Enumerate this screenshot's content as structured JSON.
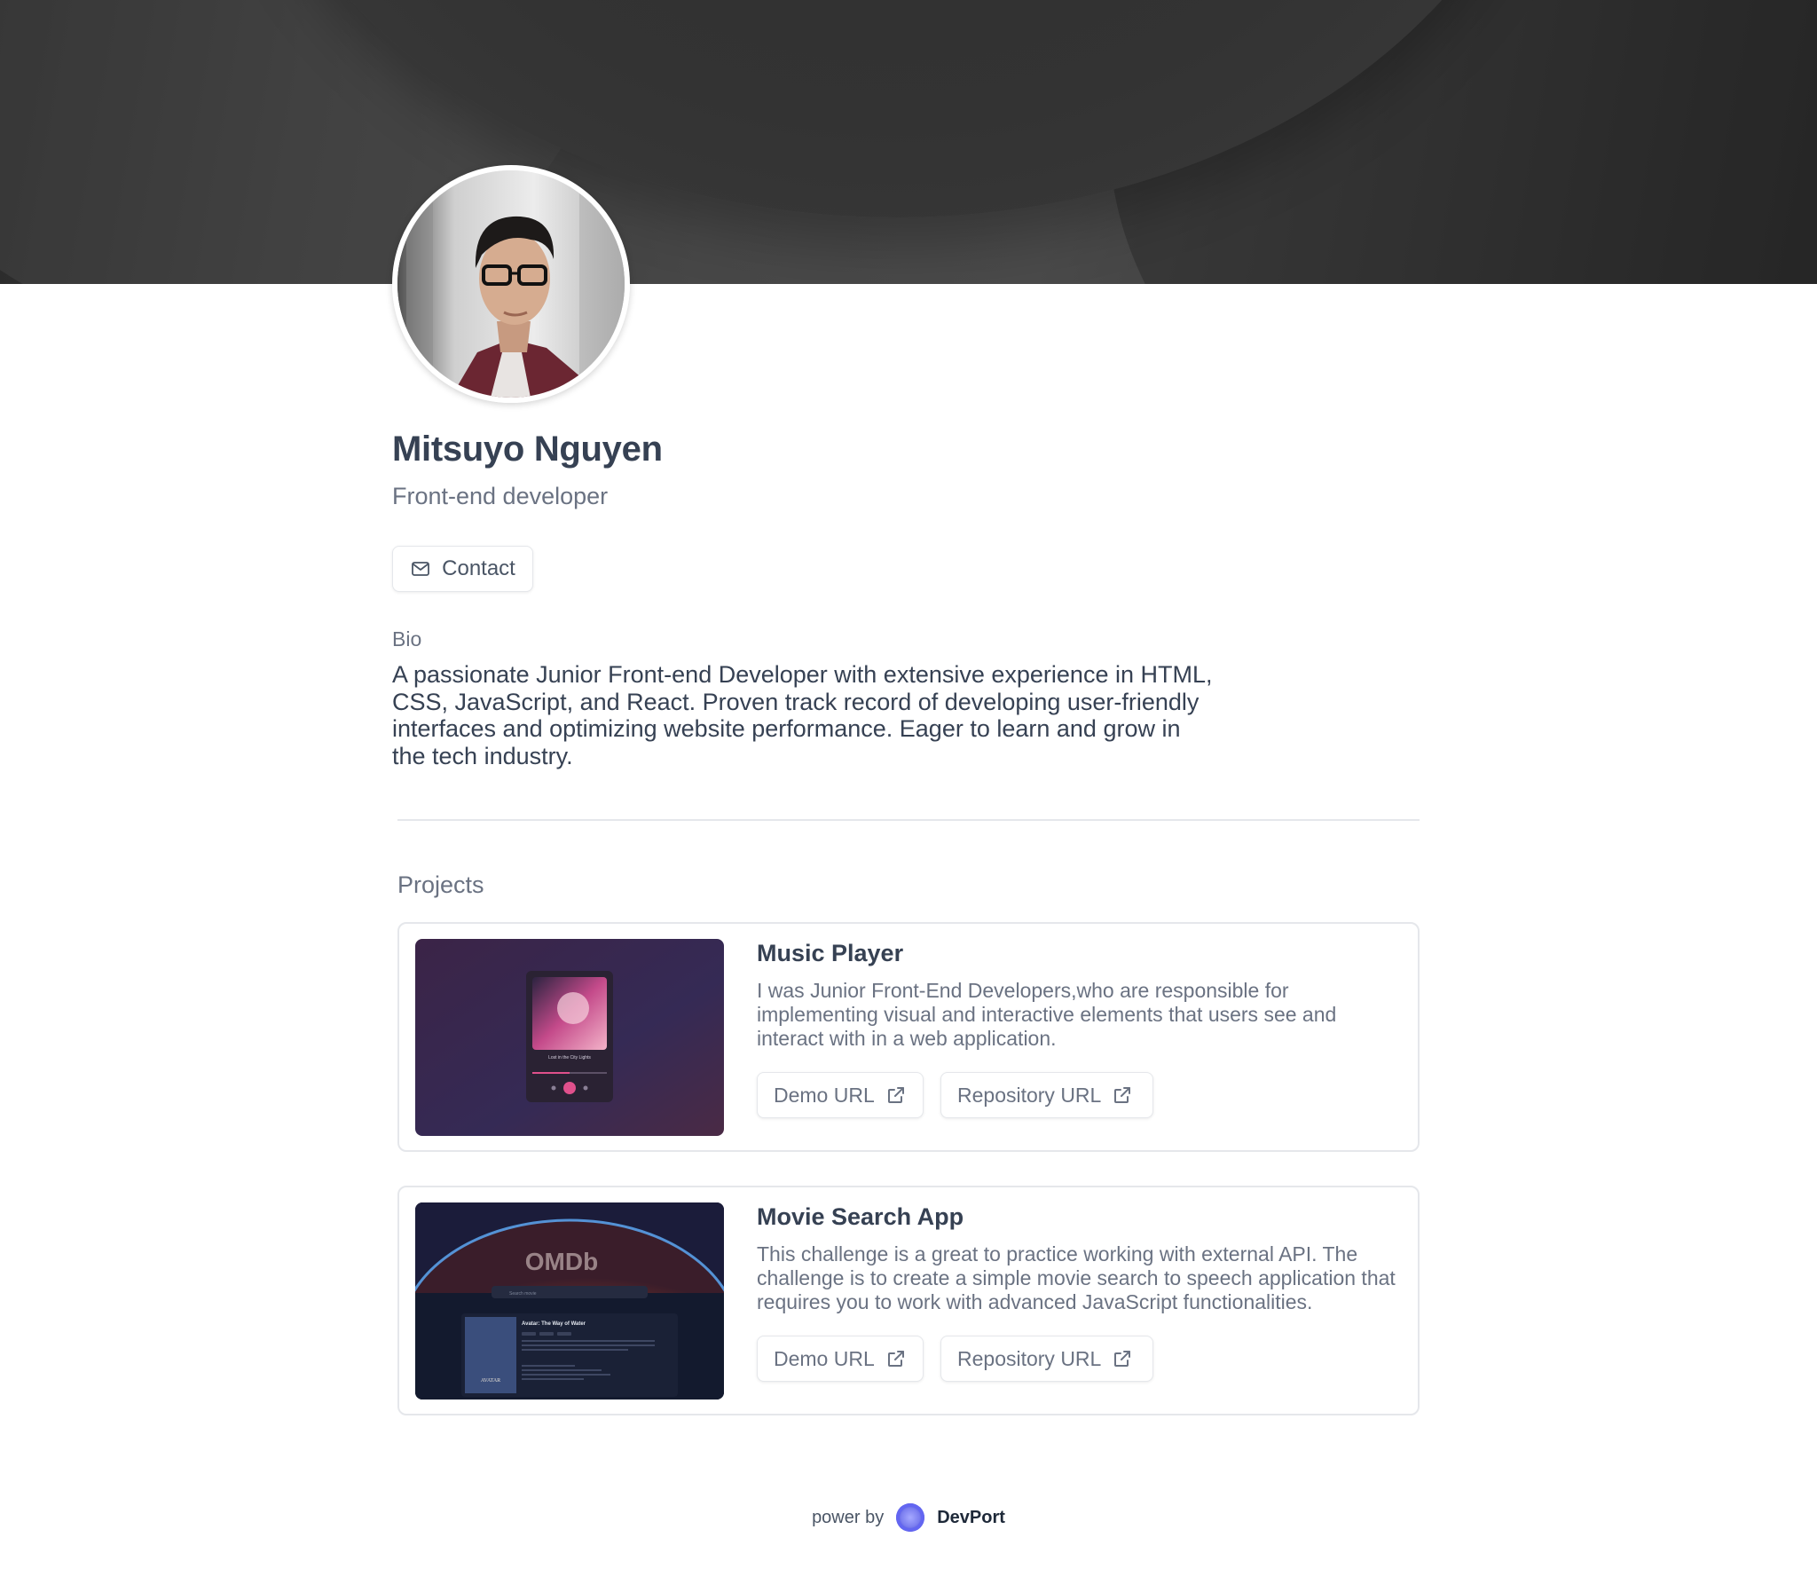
{
  "profile": {
    "name": "Mitsuyo Nguyen",
    "role": "Front-end developer",
    "contact_label": "Contact",
    "contact_icon": "mail-icon",
    "bio_label": "Bio",
    "bio_text": "A passionate Junior Front-end Developer with extensive experience in HTML, CSS, JavaScript, and React. Proven track record of developing user-friendly interfaces and optimizing website performance. Eager to learn and grow in the tech industry."
  },
  "projects": {
    "section_title": "Projects",
    "items": [
      {
        "title": "Music Player",
        "description": "I was Junior Front-End Developers,who are responsible for implementing visual and interactive elements that users see and interact with in a web application.",
        "demo_label": "Demo URL",
        "repo_label": "Repository URL",
        "thumb_caption": "Lost in the City Lights"
      },
      {
        "title": "Movie Search App",
        "description": "This challenge is a great to practice working with external API. The challenge is to create a simple movie search to speech application that requires you to work with advanced JavaScript functionalities.",
        "demo_label": "Demo URL",
        "repo_label": "Repository URL",
        "thumb_logo": "OMDb",
        "thumb_search_placeholder": "Search movie",
        "thumb_movie_title": "Avatar: The Way of Water",
        "thumb_poster_text": "AVATAR"
      }
    ]
  },
  "footer": {
    "prefix": "power by",
    "brand": "DevPort"
  },
  "colors": {
    "text_primary": "#364153",
    "text_secondary": "#6a7282",
    "border": "#e5e7eb",
    "brand_accent": "#6366f1"
  }
}
